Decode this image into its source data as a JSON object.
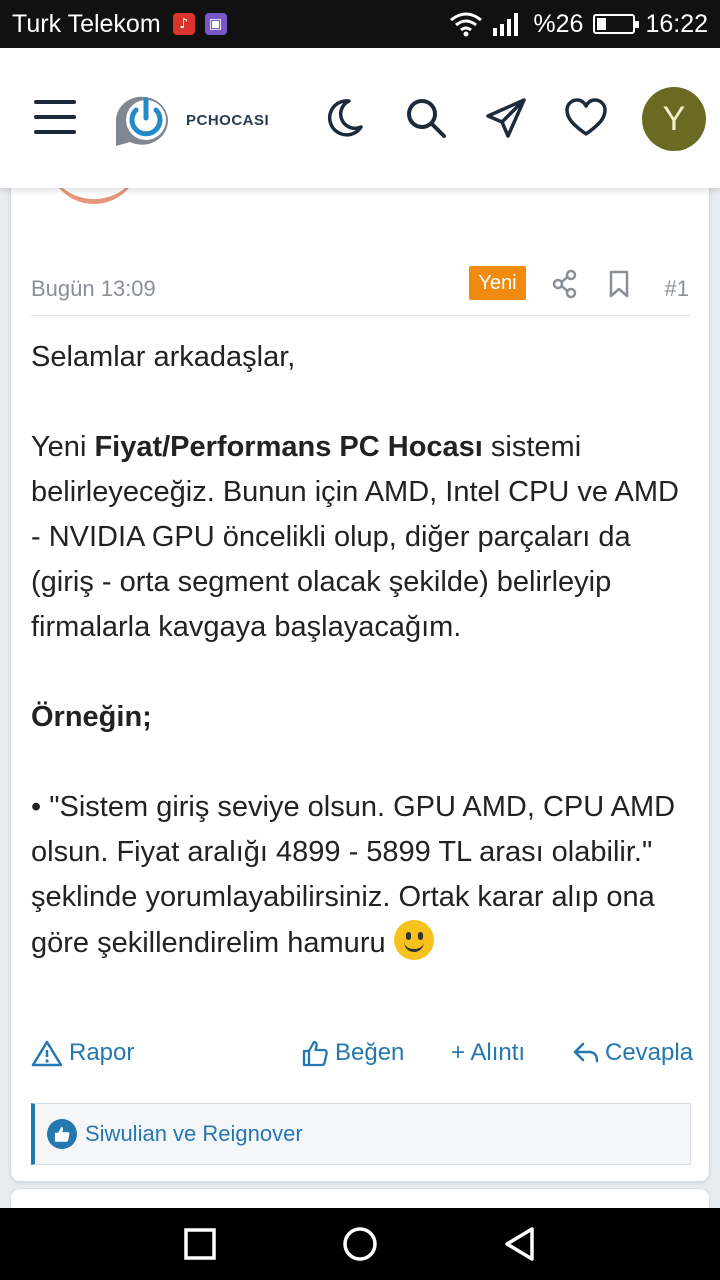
{
  "status_bar": {
    "carrier": "Turk Telekom",
    "battery": "%26",
    "battery_level": 0.26,
    "time": "16:22"
  },
  "header": {
    "logo_text": "PCHOCASI",
    "avatar_letter": "Y",
    "icons": [
      "menu-icon",
      "moon-icon",
      "search-icon",
      "send-icon",
      "heart-icon"
    ]
  },
  "post": {
    "date": "Bugün 13:09",
    "badge": "Yeni",
    "number": "#1",
    "greeting": "Selamlar arkadaşlar,",
    "p2_start": "Yeni ",
    "p2_bold": "Fiyat/Performans PC Hocası",
    "p2_rest": " sistemi belirleyeceğiz. Bunun için AMD, Intel CPU ve AMD - NVIDIA GPU öncelikli olup, diğer parçaları da (giriş - orta segment olacak şekilde) belirleyip firmalarla kavgaya başlayacağım.",
    "example_heading": "Örneğin;",
    "bullet_text": "• \"Sistem giriş seviye olsun. GPU AMD, CPU AMD olsun. Fiyat aralığı 4899 - 5899 TL arası olabilir.\" şeklinde yorumlayabilirsiniz. Ortak karar alıp ona göre şekillendirelim hamuru "
  },
  "actions": {
    "report": "Rapor",
    "like": "Beğen",
    "quote": "+ Alıntı",
    "reply": "Cevapla"
  },
  "likes": {
    "text": "Siwulian ve Reignover"
  },
  "colors": {
    "accent": "#2577b1",
    "badge": "#f08b10",
    "avatar": "#6b6a22"
  }
}
